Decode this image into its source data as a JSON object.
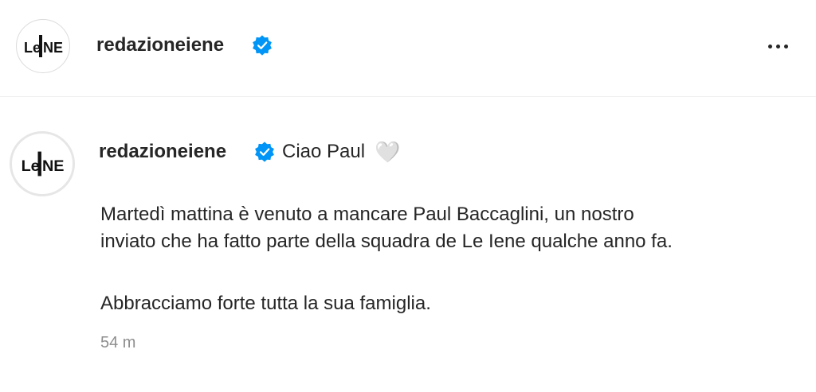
{
  "header": {
    "logo_text": "LE IENE",
    "username": "redazioneiene",
    "verified_icon": "verified-badge-icon",
    "more_icon": "more-options-icon"
  },
  "post": {
    "logo_text": "LE IENE",
    "username": "redazioneiene",
    "greeting": "Ciao Paul",
    "heart_icon": "🤍",
    "line1": "Martedì mattina è venuto a mancare Paul Baccaglini, un nostro",
    "line2": "inviato che ha fatto parte della squadra de Le Iene qualche anno fa.",
    "line3": "Abbracciamo forte tutta la sua famiglia.",
    "timestamp": "54 m"
  },
  "colors": {
    "verified_blue": "#0095f6",
    "text": "#262626",
    "muted": "#8e8e8e",
    "heart": "#cdbff0"
  }
}
